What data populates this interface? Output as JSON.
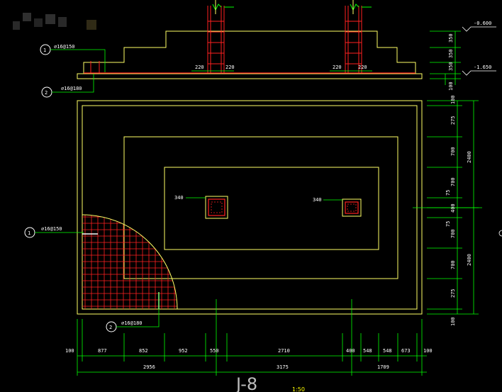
{
  "colors": {
    "background": "#000000",
    "outline": "#ffff66",
    "rebar": "#ff2020",
    "dimension": "#00ff00",
    "text": "#ffffff",
    "leader": "#00ff00"
  },
  "section": {
    "elevations": [
      "-0.600",
      "-1.650"
    ],
    "right_dims": [
      "350",
      "350",
      "350",
      "100"
    ],
    "column_dims": [
      "220",
      "220",
      "220",
      "220"
    ],
    "callout1_num": "1",
    "callout1_text": "⌀16@150",
    "callout2_num": "2",
    "callout2_text": "⌀16@180"
  },
  "plan": {
    "column_left_label": "340",
    "column_right_label": "340",
    "callout1_num": "1",
    "callout1_text": "⌀16@150",
    "callout2_num": "2",
    "callout2_text": "⌀16@180",
    "right_dims": [
      "100",
      "275",
      "700",
      "700",
      "75",
      "400",
      "75",
      "700",
      "700",
      "275",
      "100"
    ],
    "right_totals": [
      "2400",
      "2400"
    ],
    "bottom_dims": [
      "100",
      "877",
      "852",
      "952",
      "550",
      "2710",
      "400",
      "548",
      "548",
      "673",
      "100"
    ],
    "bottom_totals": [
      "2956",
      "3175",
      "1709"
    ]
  },
  "title": "J-8",
  "scale": "1:50"
}
